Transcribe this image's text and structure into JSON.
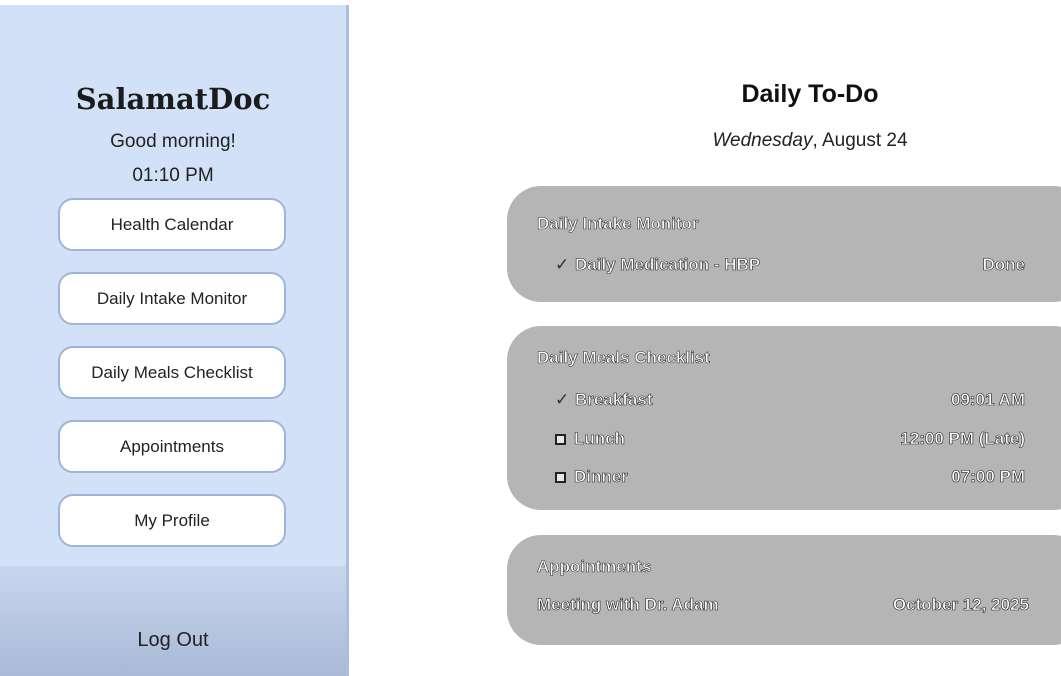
{
  "sidebar": {
    "brand": "SalamatDoc",
    "greeting": "Good morning!",
    "time": "01:10 PM",
    "nav": [
      {
        "label": "Health Calendar"
      },
      {
        "label": "Daily Intake Monitor"
      },
      {
        "label": "Daily Meals Checklist"
      },
      {
        "label": "Appointments"
      },
      {
        "label": "My Profile"
      }
    ],
    "logout_label": "Log Out"
  },
  "main": {
    "title": "Daily To-Do",
    "date_day": "Wednesday",
    "date_rest": ", August 24",
    "sections": [
      {
        "title": "Daily Intake Monitor",
        "items": [
          {
            "status": "checked",
            "mark": "✓",
            "label": "Daily Medication - HBP",
            "value": "Done"
          }
        ]
      },
      {
        "title": "Daily Meals Checklist",
        "items": [
          {
            "status": "checked",
            "mark": "✓",
            "label": "Breakfast",
            "value": "09:01 AM"
          },
          {
            "status": "unchecked",
            "mark": "",
            "label": "Lunch",
            "value": "12:00 PM (Late)"
          },
          {
            "status": "unchecked",
            "mark": "",
            "label": "Dinner",
            "value": "07:00 PM"
          }
        ]
      },
      {
        "title": "Appointments",
        "items": [
          {
            "status": "none",
            "mark": "",
            "label": "Meeting with Dr. Adam",
            "value": "October 12, 2025"
          }
        ]
      }
    ]
  },
  "colors": {
    "sidebar_bg": "#d2e1f7",
    "button_border": "#9fb5d8",
    "card_bg": "#b5b5b5"
  }
}
